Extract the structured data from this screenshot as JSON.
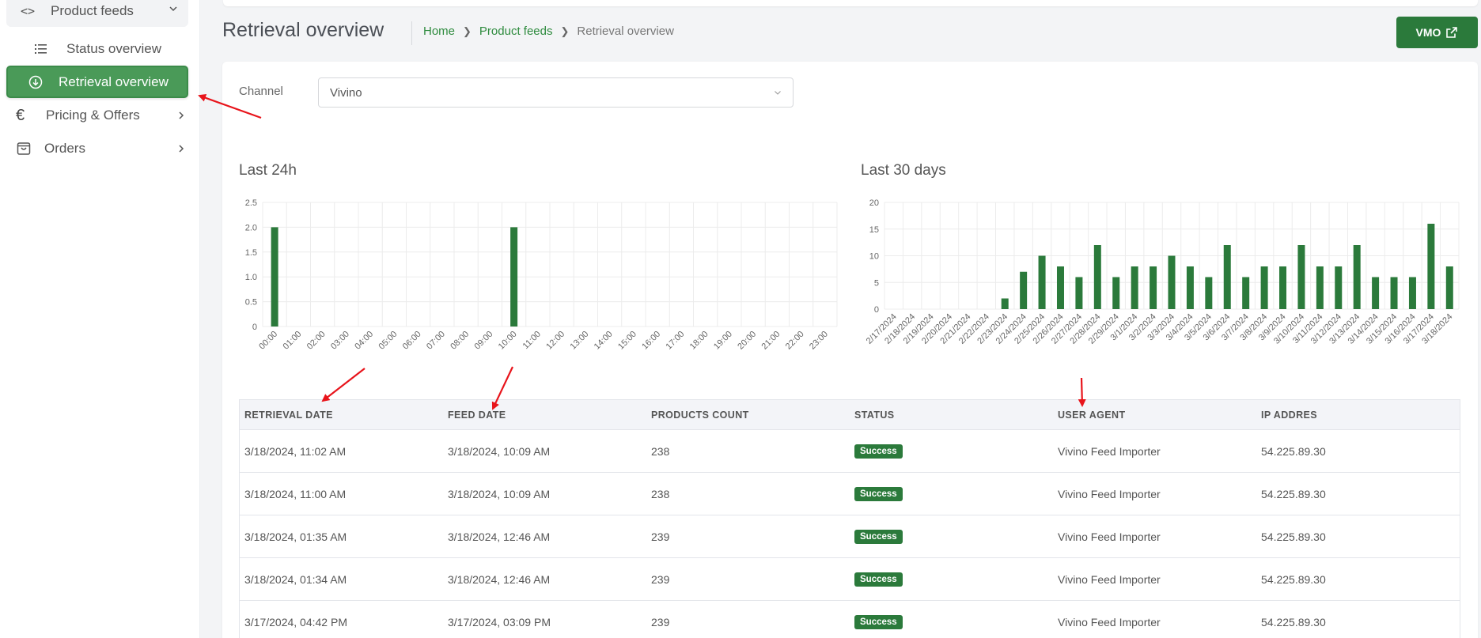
{
  "sidebar": {
    "parent": {
      "label": "Product feeds"
    },
    "items": [
      {
        "label": "Status overview"
      },
      {
        "label": "Retrieval overview"
      },
      {
        "label": "Pricing & Offers"
      },
      {
        "label": "Orders"
      }
    ]
  },
  "header": {
    "title": "Retrieval overview",
    "breadcrumb": [
      "Home",
      "Product feeds",
      "Retrieval overview"
    ],
    "vmo_label": "VMO"
  },
  "filter": {
    "channel_label": "Channel",
    "channel_value": "Vivino"
  },
  "charts": {
    "last24_title": "Last 24h",
    "last30_title": "Last 30 days"
  },
  "chart_data": [
    {
      "type": "bar",
      "title": "Last 24h",
      "categories": [
        "00:00",
        "01:00",
        "02:00",
        "03:00",
        "04:00",
        "05:00",
        "06:00",
        "07:00",
        "08:00",
        "09:00",
        "10:00",
        "11:00",
        "12:00",
        "13:00",
        "14:00",
        "15:00",
        "16:00",
        "17:00",
        "18:00",
        "19:00",
        "20:00",
        "21:00",
        "22:00",
        "23:00"
      ],
      "values": [
        2,
        0,
        0,
        0,
        0,
        0,
        0,
        0,
        0,
        0,
        2,
        0,
        0,
        0,
        0,
        0,
        0,
        0,
        0,
        0,
        0,
        0,
        0,
        0
      ],
      "yticks": [
        "0",
        "0.5",
        "1.0",
        "1.5",
        "2.0",
        "2.5"
      ],
      "ylim": [
        0,
        2.5
      ],
      "grid": true,
      "color": "#2b7a3b"
    },
    {
      "type": "bar",
      "title": "Last 30 days",
      "categories": [
        "2/17/2024",
        "2/18/2024",
        "2/19/2024",
        "2/20/2024",
        "2/21/2024",
        "2/22/2024",
        "2/23/2024",
        "2/24/2024",
        "2/25/2024",
        "2/26/2024",
        "2/27/2024",
        "2/28/2024",
        "2/29/2024",
        "3/1/2024",
        "3/2/2024",
        "3/3/2024",
        "3/4/2024",
        "3/5/2024",
        "3/6/2024",
        "3/7/2024",
        "3/8/2024",
        "3/9/2024",
        "3/10/2024",
        "3/11/2024",
        "3/12/2024",
        "3/13/2024",
        "3/14/2024",
        "3/15/2024",
        "3/16/2024",
        "3/17/2024",
        "3/18/2024"
      ],
      "values": [
        0,
        0,
        0,
        0,
        0,
        0,
        2,
        7,
        10,
        8,
        6,
        12,
        6,
        8,
        8,
        10,
        8,
        6,
        12,
        6,
        8,
        8,
        12,
        8,
        8,
        12,
        6,
        6,
        6,
        16,
        8
      ],
      "yticks": [
        "0",
        "5",
        "10",
        "15",
        "20"
      ],
      "ylim": [
        0,
        20
      ],
      "grid": true,
      "color": "#2b7a3b"
    }
  ],
  "table": {
    "headers": [
      "RETRIEVAL DATE",
      "FEED DATE",
      "PRODUCTS COUNT",
      "STATUS",
      "USER AGENT",
      "IP ADDRES"
    ],
    "rows": [
      [
        "3/18/2024, 11:02 AM",
        "3/18/2024, 10:09 AM",
        "238",
        "Success",
        "Vivino Feed Importer",
        "54.225.89.30"
      ],
      [
        "3/18/2024, 11:00 AM",
        "3/18/2024, 10:09 AM",
        "238",
        "Success",
        "Vivino Feed Importer",
        "54.225.89.30"
      ],
      [
        "3/18/2024, 01:35 AM",
        "3/18/2024, 12:46 AM",
        "239",
        "Success",
        "Vivino Feed Importer",
        "54.225.89.30"
      ],
      [
        "3/18/2024, 01:34 AM",
        "3/18/2024, 12:46 AM",
        "239",
        "Success",
        "Vivino Feed Importer",
        "54.225.89.30"
      ],
      [
        "3/17/2024, 04:42 PM",
        "3/17/2024, 03:09 PM",
        "239",
        "Success",
        "Vivino Feed Importer",
        "54.225.89.30"
      ]
    ]
  },
  "colors": {
    "accent": "#2b7a3b",
    "active_bg": "#4a9a58",
    "annotation": "#e8141b"
  }
}
